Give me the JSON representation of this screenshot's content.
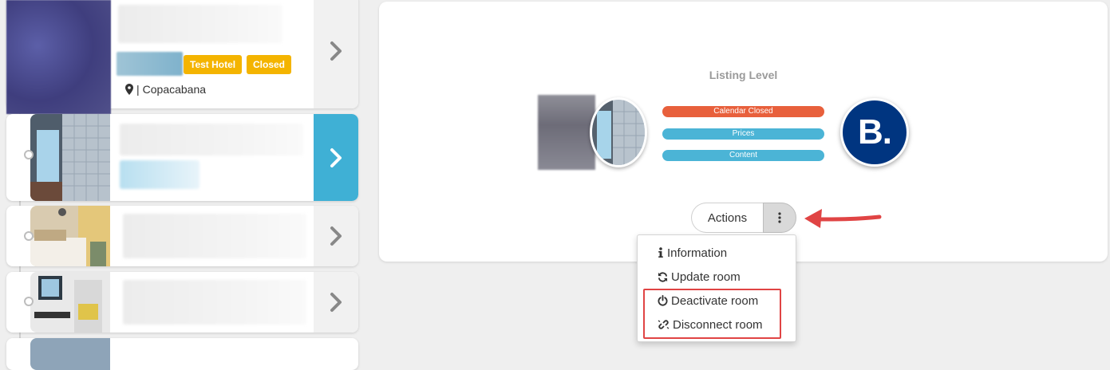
{
  "listings": {
    "top": {
      "badges": [
        "Test Hotel",
        "Closed"
      ],
      "location_separator": "|",
      "location": "Copacabana"
    }
  },
  "detail": {
    "section_title": "Listing Level",
    "status_pills": [
      {
        "label": "Calendar Closed",
        "color": "#e8603c"
      },
      {
        "label": "Prices",
        "color": "#4bb4d6"
      },
      {
        "label": "Content",
        "color": "#4bb4d6"
      }
    ],
    "channel_logo_text": "B.",
    "actions_label": "Actions"
  },
  "actions_menu": {
    "items": [
      {
        "label": "Information",
        "icon": "info-icon"
      },
      {
        "label": "Update room",
        "icon": "refresh-icon"
      },
      {
        "label": "Deactivate room",
        "icon": "power-icon"
      },
      {
        "label": "Disconnect room",
        "icon": "unlink-icon"
      }
    ]
  },
  "colors": {
    "accent": "#3fb0d5",
    "badge": "#f4b400",
    "booking_blue": "#003580",
    "annotation_red": "#e04444"
  }
}
